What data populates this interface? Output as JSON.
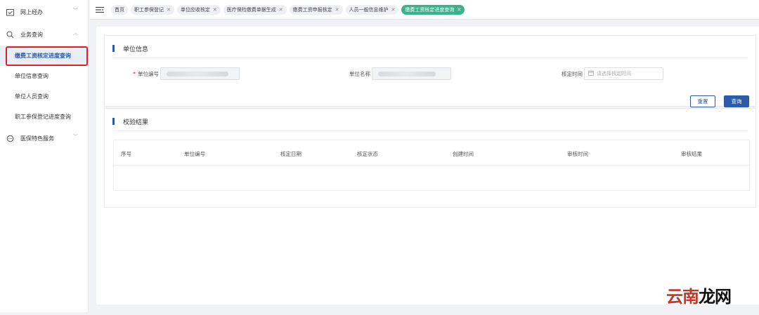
{
  "sidebar": {
    "groups": [
      {
        "label": "网上经办"
      },
      {
        "label": "业务查询"
      },
      {
        "label": "医保特色服务"
      }
    ],
    "items": [
      {
        "label": "缴费工资核定进度查询"
      },
      {
        "label": "单位信息查询"
      },
      {
        "label": "单位人员查询"
      },
      {
        "label": "职工参保登记进度查询"
      }
    ]
  },
  "tabs": [
    {
      "label": "首页"
    },
    {
      "label": "职工参保登记"
    },
    {
      "label": "单位应收核定"
    },
    {
      "label": "医疗保险缴费单据生成"
    },
    {
      "label": "缴费工资申报核定"
    },
    {
      "label": "人员一般信息维护"
    },
    {
      "label": "缴费工资核定进度查询"
    }
  ],
  "card1": {
    "title": "单位信息",
    "unit_no_label": "单位编号",
    "required_mark": "*",
    "unit_name_label": "单位名称",
    "verify_time_label": "核定时间",
    "verify_time_placeholder": "请选择核定时间",
    "reset_label": "重置",
    "query_label": "查询"
  },
  "card2": {
    "title": "校验结果",
    "columns": [
      "序号",
      "单位编号",
      "核定日期",
      "核定状态",
      "创建时间",
      "审核时间",
      "审核结果"
    ]
  },
  "watermark": {
    "part1": "云南",
    "part2": "龙网"
  }
}
